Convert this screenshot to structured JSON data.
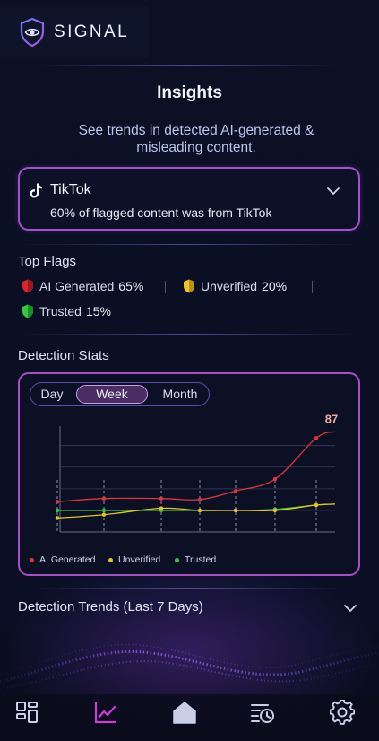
{
  "app": {
    "name": "SIGNAL"
  },
  "header": {
    "title": "Insights",
    "subtitle": "See trends in detected AI-generated & misleading content."
  },
  "platform": {
    "name": "TikTok",
    "stat": "60% of flagged content was from TikTok",
    "icon": "tiktok-icon"
  },
  "top_flags": {
    "label": "Top Flags",
    "items": [
      {
        "name": "AI Generated",
        "value": "65%",
        "color": "#e02f3a",
        "icon": "shield-icon"
      },
      {
        "name": "Unverified",
        "value": "20%",
        "color": "#e8c21c",
        "icon": "shield-icon"
      },
      {
        "name": "Trusted",
        "value": "15%",
        "color": "#2fc43a",
        "icon": "shield-icon"
      }
    ]
  },
  "detection_stats": {
    "label": "Detection Stats",
    "range_tabs": [
      "Day",
      "Week",
      "Month"
    ],
    "selected_tab": "Week"
  },
  "chart_data": {
    "type": "line",
    "title": "",
    "xlabel": "",
    "ylabel": "",
    "ylim": [
      0,
      100
    ],
    "grid": true,
    "legend_position": "bottom-left",
    "peak_label": "87",
    "series": [
      {
        "name": "AI Generated",
        "color": "#e2343c",
        "values": [
          28,
          31,
          31,
          30,
          38,
          49,
          87
        ]
      },
      {
        "name": "Unverified",
        "color": "#e5c320",
        "values": [
          13,
          16,
          22,
          20,
          20,
          20,
          25
        ]
      },
      {
        "name": "Trusted",
        "color": "#35c743",
        "values": [
          20,
          20,
          20,
          20,
          20,
          21,
          25
        ]
      }
    ]
  },
  "trends": {
    "label": "Detection Trends (Last 7 Days)"
  },
  "nav": {
    "items": [
      {
        "name": "dashboard",
        "icon": "grid-icon"
      },
      {
        "name": "insights",
        "icon": "chart-icon",
        "active": true
      },
      {
        "name": "home",
        "icon": "home-icon"
      },
      {
        "name": "history",
        "icon": "history-icon"
      },
      {
        "name": "settings",
        "icon": "gear-icon"
      }
    ],
    "active_color": "#d23ad8",
    "inactive_color": "#c9cfe6"
  }
}
